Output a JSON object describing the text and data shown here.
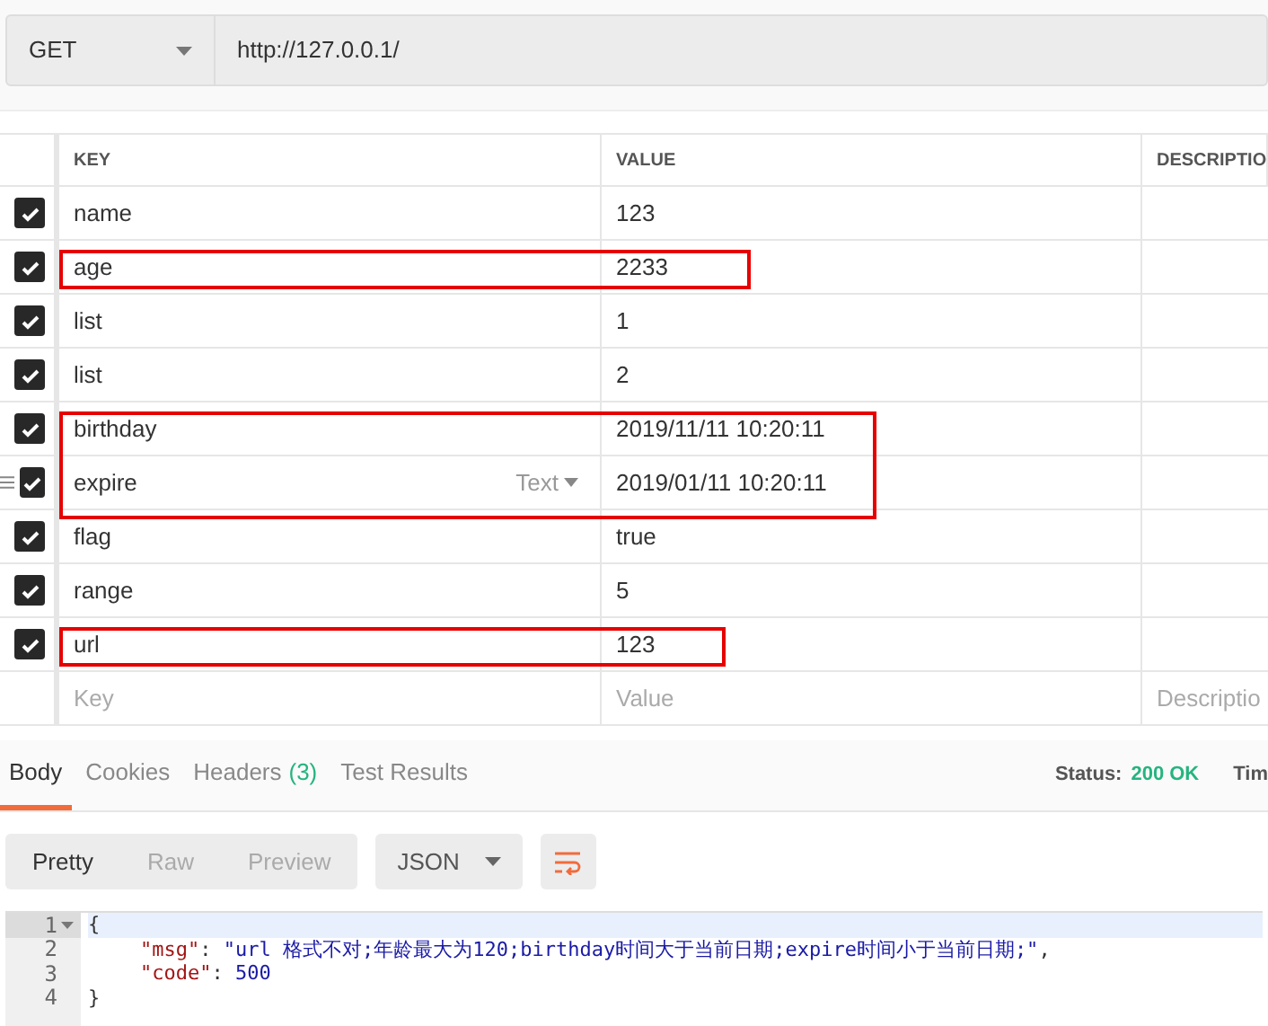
{
  "request": {
    "method": "GET",
    "url": "http://127.0.0.1/"
  },
  "table": {
    "columns": [
      "KEY",
      "VALUE",
      "DESCRIPTIO"
    ],
    "rows": [
      {
        "key": "name",
        "value": "123",
        "checked": true,
        "marked": false
      },
      {
        "key": "age",
        "value": "2233",
        "checked": true,
        "marked": true
      },
      {
        "key": "list",
        "value": "1",
        "checked": true,
        "marked": false
      },
      {
        "key": "list",
        "value": "2",
        "checked": true,
        "marked": false
      },
      {
        "key": "birthday",
        "value": "2019/11/11 10:20:11",
        "checked": true,
        "marked": true
      },
      {
        "key": "expire",
        "value": "2019/01/11 10:20:11",
        "checked": true,
        "marked": true,
        "hovered": true,
        "type": "Text"
      },
      {
        "key": "flag",
        "value": "true",
        "checked": true,
        "marked": false
      },
      {
        "key": "range",
        "value": "5",
        "checked": true,
        "marked": false
      },
      {
        "key": "url",
        "value": "123",
        "checked": true,
        "marked": true
      }
    ],
    "new_row": {
      "key_placeholder": "Key",
      "value_placeholder": "Value",
      "description_placeholder": "Descriptio"
    }
  },
  "response": {
    "tabs": [
      {
        "label": "Body",
        "selected": true
      },
      {
        "label": "Cookies",
        "selected": false
      },
      {
        "label": "Headers",
        "count": "(3)",
        "selected": false
      },
      {
        "label": "Test Results",
        "selected": false
      }
    ],
    "status_label": "Status:",
    "status": "200 OK",
    "time_label": "Tim",
    "views": [
      {
        "label": "Pretty",
        "selected": true
      },
      {
        "label": "Raw",
        "selected": false
      },
      {
        "label": "Preview",
        "selected": false
      }
    ],
    "format": "JSON",
    "code": [
      {
        "number": "1",
        "fold": true,
        "tokens": [
          {
            "kind": "punct",
            "text": "{"
          }
        ]
      },
      {
        "number": "2",
        "fold": false,
        "tokens": [
          {
            "kind": "key",
            "text": "\"msg\""
          },
          {
            "kind": "punct",
            "text": ": "
          },
          {
            "kind": "string",
            "text": "\"url 格式不对;年龄最大为120;birthday时间大于当前日期;expire时间小于当前日期;\""
          },
          {
            "kind": "punct",
            "text": ","
          }
        ]
      },
      {
        "number": "3",
        "fold": false,
        "tokens": [
          {
            "kind": "key",
            "text": "\"code\""
          },
          {
            "kind": "punct",
            "text": ": "
          },
          {
            "kind": "number",
            "text": "500"
          }
        ]
      },
      {
        "number": "4",
        "fold": false,
        "tokens": [
          {
            "kind": "punct",
            "text": "}"
          }
        ]
      }
    ]
  }
}
